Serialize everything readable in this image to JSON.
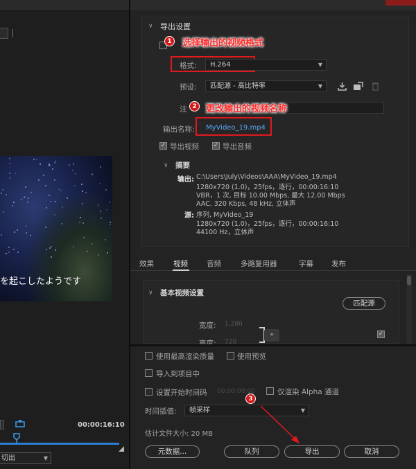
{
  "preview": {
    "subtitle": "を起こしたようです",
    "timecode": "00:00:16:10",
    "fit_label": "切出"
  },
  "export_settings": {
    "title": "导出设置",
    "format_label": "格式:",
    "format_value": "H.264",
    "preset_label": "预设:",
    "preset_value": "匹配源 - 高比特率",
    "comment_label": "注",
    "output_name_label": "输出名称:",
    "output_name_value": "MyVideo_19.mp4",
    "export_video_label": "导出视频",
    "export_audio_label": "导出音频"
  },
  "summary": {
    "title": "摘要",
    "output_key": "输出:",
    "output_lines": [
      "C:\\Users\\July\\Videos\\AAA\\MyVideo_19.mp4",
      "1280x720 (1.0)，25fps，逐行，00:00:16:10",
      "VBR，1 次, 目标 10.00 Mbps, 最大 12.00 Mbps",
      "AAC, 320 Kbps, 48 kHz, 立体声"
    ],
    "source_key": "源:",
    "source_lines": [
      "序列, MyVideo_19",
      "1280x720 (1.0)，25fps，逐行，00:00:16:10",
      "44100 Hz，立体声"
    ]
  },
  "tabs": [
    "效果",
    "视频",
    "音频",
    "多路复用器",
    "字幕",
    "发布"
  ],
  "video_settings": {
    "title": "基本视频设置",
    "match_source_button": "匹配源",
    "width_label": "宽度:",
    "width_value": "1,280",
    "height_label": "高度:",
    "height_value": "720"
  },
  "bottom": {
    "max_render_quality": "使用最高渲染质量",
    "use_previews": "使用预览",
    "import_into_project": "导入到项目中",
    "set_start_timecode": "设置开始时间码",
    "start_timecode_value": "00:00:00:00",
    "render_alpha_only": "仅渲染 Alpha 通道",
    "time_interpolation_label": "时间插值:",
    "time_interpolation_value": "帧采样",
    "estimated_size": "估计文件大小: 20 MB",
    "metadata_button": "元数据...",
    "queue_button": "队列",
    "export_button": "导出",
    "cancel_button": "取消"
  },
  "annotations": {
    "badge_1": "1",
    "text_1": "选择输出的视频格式",
    "badge_2": "2",
    "text_2": "更改输出的视频名称",
    "badge_3": "3",
    "color": "#e0191e"
  }
}
